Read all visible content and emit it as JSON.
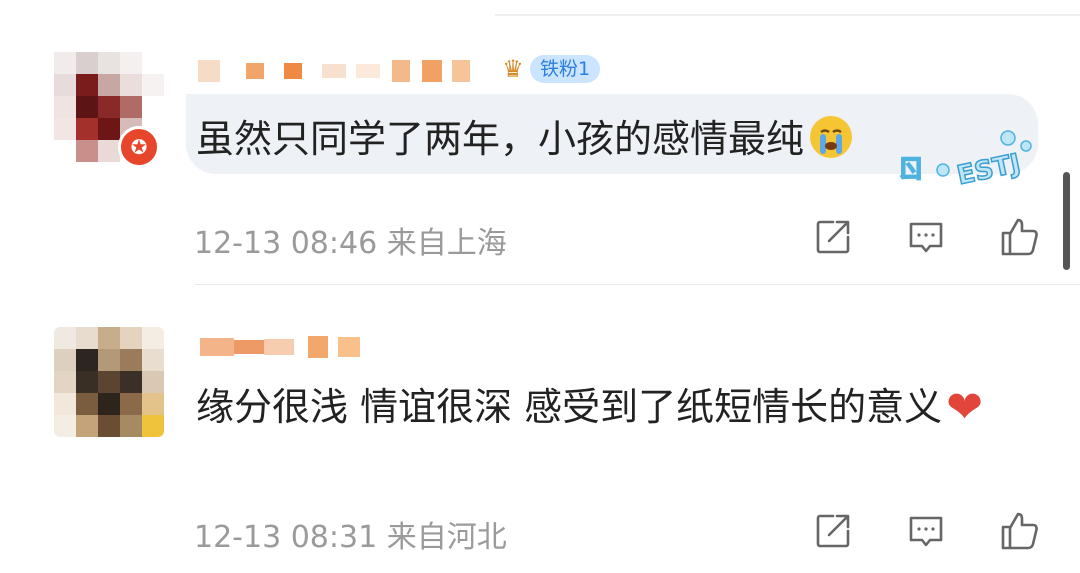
{
  "comments": [
    {
      "text": "虽然只同学了两年，小孩的感情最纯",
      "time": "12-13 08:46",
      "location": "来自上海",
      "fan_badge": "铁粉1",
      "emoji": "crying-face",
      "sticker_text": "ESTJ",
      "actions": [
        "share-icon",
        "comment-icon",
        "like-icon"
      ]
    },
    {
      "text": "缘分很浅 情谊很深 感受到了纸短情长的意义",
      "time": "12-13 08:31",
      "location": "来自河北",
      "emoji": "red-heart",
      "actions": [
        "share-icon",
        "comment-icon",
        "like-icon"
      ]
    }
  ],
  "colors": {
    "text": "#222222",
    "meta": "#9a9a9a",
    "bubble": "#eef2f7",
    "badge_bg": "#cbe4ff",
    "badge_text": "#2b7fe0",
    "heart": "#e2453a"
  }
}
